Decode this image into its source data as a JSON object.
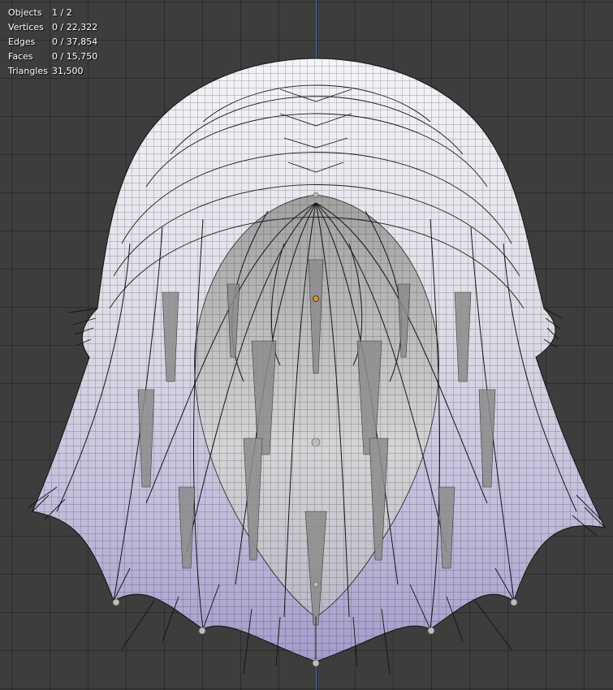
{
  "viewport": {
    "stats": [
      {
        "label": "Objects",
        "value": "1 / 2"
      },
      {
        "label": "Vertices",
        "value": "0 / 22,322"
      },
      {
        "label": "Edges",
        "value": "0 / 37,854"
      },
      {
        "label": "Faces",
        "value": "0 / 15,750"
      },
      {
        "label": "Triangles",
        "value": "31,500"
      }
    ]
  },
  "colors": {
    "background": "#3d3d3d",
    "axis": "#3f6fa8",
    "origin": "#e8902a"
  }
}
